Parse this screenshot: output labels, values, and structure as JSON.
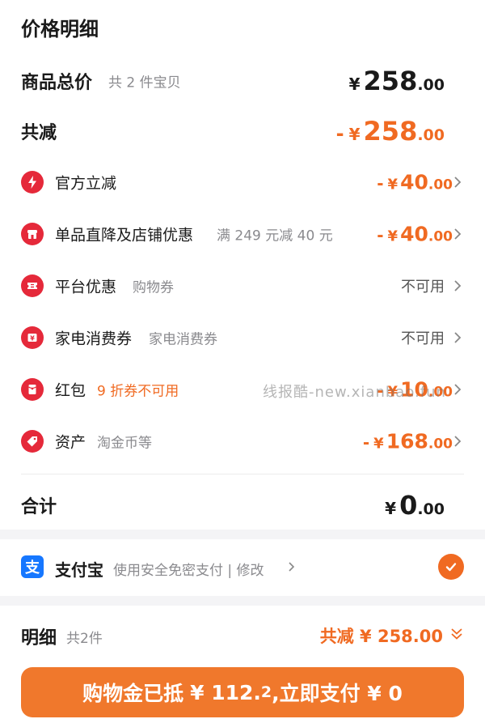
{
  "header": {
    "title": "价格明细"
  },
  "goods_total": {
    "label": "商品总价",
    "sub": "共 2 件宝贝",
    "currency": "¥",
    "int": "258",
    "dec": ".00"
  },
  "total_reduce": {
    "label": "共减",
    "dash": "-",
    "currency": "¥",
    "int": "258",
    "dec": ".00"
  },
  "items": [
    {
      "label": "官方立减",
      "sub": "",
      "dash": "-",
      "currency": "¥",
      "int": "40",
      "dec": ".00",
      "icon": "lightning-icon"
    },
    {
      "label": "单品直降及店铺优惠",
      "sub": "满 249 元减 40 元",
      "dash": "-",
      "currency": "¥",
      "int": "40",
      "dec": ".00",
      "icon": "shop-icon"
    },
    {
      "label": "平台优惠",
      "sub": "购物券",
      "status": "不可用",
      "icon": "ticket-icon"
    },
    {
      "label": "家电消费券",
      "sub": "家电消费券",
      "status": "不可用",
      "icon": "coupon-icon"
    },
    {
      "label": "红包",
      "sub": "9 折券不可用",
      "dash": "-",
      "currency": "¥",
      "int": "10",
      "dec": ".00",
      "icon": "red-packet-icon"
    },
    {
      "label": "资产",
      "sub": "淘金币等",
      "dash": "-",
      "currency": "¥",
      "int": "168",
      "dec": ".00",
      "icon": "tag-icon"
    }
  ],
  "subtotal": {
    "label": "合计",
    "currency": "¥",
    "int": "0",
    "dec": ".00"
  },
  "watermark": "线报酷-new.xianbao.fun",
  "payment": {
    "icon_glyph": "支",
    "name": "支付宝",
    "desc": "使用安全免密支付 | 修改"
  },
  "detail": {
    "title": "明细",
    "count": "共2件",
    "total": "共减 ¥ 258.00"
  },
  "pay_button": {
    "part1": "购物金已抵",
    "part2": "¥ 112.",
    "part3": "2",
    "part4": ",立即支付 ¥ 0"
  },
  "colors": {
    "accent": "#f06a22",
    "icon_red": "#e5293a",
    "alipay_blue": "#1677ff"
  }
}
